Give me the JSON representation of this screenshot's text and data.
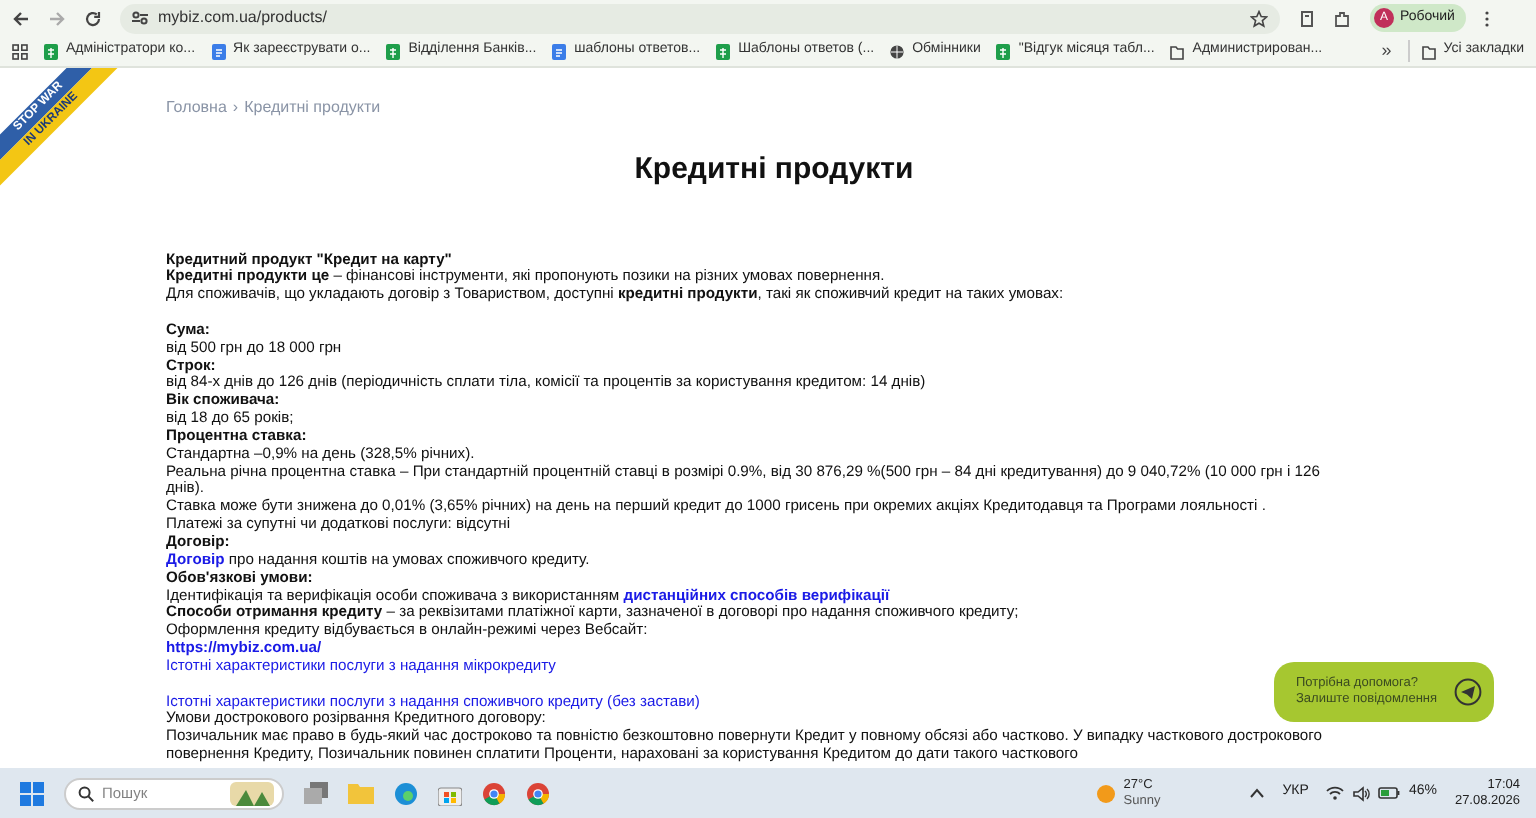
{
  "browser": {
    "url": "mybiz.com.ua/products/",
    "profile_initial": "A",
    "profile": "Робочий",
    "bookmarks": [
      {
        "kind": "sheet",
        "label": "Адміністратори ко..."
      },
      {
        "kind": "doc",
        "label": "Як зареєструвати о..."
      },
      {
        "kind": "sheet",
        "label": "Відділення Банків..."
      },
      {
        "kind": "doc",
        "label": "шаблоны ответов..."
      },
      {
        "kind": "sheet",
        "label": "Шаблоны ответов (..."
      },
      {
        "kind": "globe",
        "label": "Обмінники"
      },
      {
        "kind": "sheet",
        "label": "\"Відгук місяця табл..."
      },
      {
        "kind": "folder",
        "label": "Администрирован..."
      }
    ],
    "more": "»",
    "all_bookmarks": "Усі закладки"
  },
  "page": {
    "ribbon": [
      "STOP WAR",
      "IN UKRAINE"
    ],
    "breadcrumb": [
      "Головна",
      "›",
      "Кредитні продукти"
    ],
    "title": "Кредитні продукти",
    "blocks": [
      [
        [
          {
            "kind": "heading",
            "text": "Кредитний продукт \"Кредит на карту\""
          }
        ],
        [
          {
            "kind": "text",
            "text": "**Кредитні продукти це** –  фінансові інструменти, які пропонують позики на різних умовах повернення."
          }
        ],
        [
          {
            "kind": "text",
            "text": "Для споживачів, що укладають договір з Товариством, доступні **кредитні продукти**, такі як споживчий кредит на таких умовах:"
          }
        ]
      ],
      [
        [
          {
            "kind": "heading",
            "text": "Сума:"
          }
        ],
        [
          {
            "kind": "text",
            "text": "від 500 грн до 18 000 грн"
          }
        ],
        [
          {
            "kind": "heading",
            "text": "Строк:"
          }
        ],
        [
          {
            "kind": "text",
            "text": "від 84-х днів до 126 днів (періодичність сплати тіла, комісії та процентів за користування кредитом: 14 днів)"
          }
        ],
        [
          {
            "kind": "heading",
            "text": "Вік споживача:"
          }
        ],
        [
          {
            "kind": "text",
            "text": "від 18 до 65 років;"
          }
        ],
        [
          {
            "kind": "heading",
            "text": "Процентна ставка:"
          }
        ],
        [
          {
            "kind": "text",
            "text": "Стандартна –0,9% на день (328,5% річних)."
          }
        ],
        [
          {
            "kind": "text",
            "text": "Реальна річна процентна ставка – При стандартній процентній ставці в розмірі 0.9%, від 30 876,29 %(500 грн – 84 дні кредитування) до 9 040,72% (10 000 грн і 126 днів)."
          }
        ],
        [
          {
            "kind": "text",
            "text": "Ставка може бути знижена до 0,01% (3,65% річних) на день на перший кредит до 1000 грисень при окремих акціях Кредитодавця та Програми лояльності ."
          }
        ],
        [
          {
            "kind": "text",
            "text": "Платежі за супутні чи додаткові послуги: відсутні"
          }
        ],
        [
          {
            "kind": "heading",
            "text": "Договір:"
          }
        ],
        [
          {
            "kind": "strong_link",
            "text": "Договір"
          },
          {
            "kind": "text",
            "text": " про надання коштів на умовах споживчого кредиту."
          }
        ],
        [
          {
            "kind": "heading",
            "text": "Обов'язкові умови:"
          }
        ],
        [
          {
            "kind": "text",
            "text": "Ідентифікація та верифікація особи споживача з використанням "
          },
          {
            "kind": "strong_link",
            "text": "дистанційних способів верифікації"
          }
        ],
        [
          {
            "kind": "text",
            "text": "**Способи отримання кредиту** – за реквізитами платіжної карти, зазначеної в договорі про надання споживчого кредиту;"
          }
        ],
        [
          {
            "kind": "text",
            "text": "Оформлення кредиту відбувається в онлайн-режимі через Вебсайт:"
          }
        ],
        [
          {
            "kind": "strong_link",
            "text": "https://mybiz.com.ua/"
          }
        ],
        [
          {
            "kind": "link",
            "text": "Істотні характеристики послуги з надання мікрокредиту"
          }
        ]
      ],
      [
        [
          {
            "kind": "link",
            "text": "Істотні характеристики послуги з надання споживчого кредиту (без застави)"
          }
        ],
        [
          {
            "kind": "text",
            "text": "Умови дострокового розірвання Кредитного договору:"
          }
        ],
        [
          {
            "kind": "text",
            "text": "Позичальник має право в будь-який час достроково та повністю безкоштовно повернути Кредит у повному обсязі або частково. У випадку часткового дострокового повернення Кредиту, Позичальник повинен сплатити Проценти, нараховані за користування Кредитом до дати такого часткового"
          }
        ]
      ]
    ],
    "chat": [
      "Потрібна допомога?",
      "Залиште повідомлення"
    ]
  },
  "taskbar": {
    "search_placeholder": "Пошук",
    "temperature": "27°C",
    "weather": "Sunny",
    "language": "УКР",
    "battery": "46%",
    "time": "17:04",
    "date": "27.08.2026"
  }
}
